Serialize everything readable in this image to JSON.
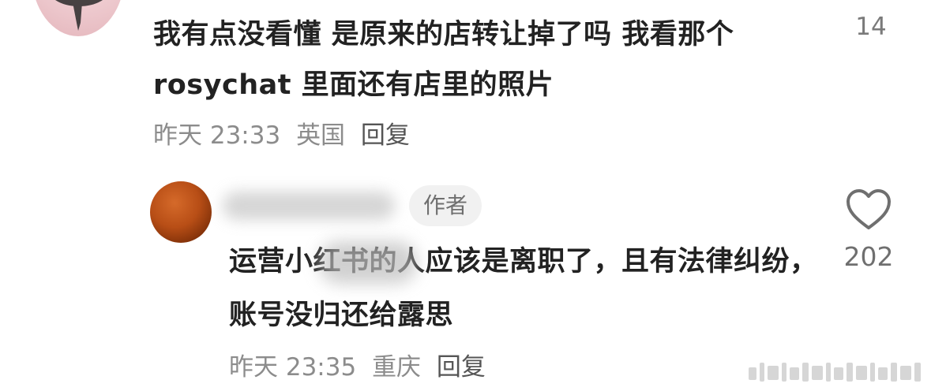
{
  "comment": {
    "text": "我有点没看懂 是原来的店转让掉了吗 我看那个 rosychat 里面还有店里的照片",
    "time": "昨天 23:33",
    "location": "英国",
    "reply_label": "回复",
    "likes": "14"
  },
  "reply": {
    "author_badge": "作者",
    "text": "运营小红书的人应该是离职了，且有法律纠纷，账号没归还给露思",
    "time": "昨天 23:35",
    "location": "重庆",
    "reply_label": "回复",
    "likes": "202",
    "heart_icon": "heart-outline-icon"
  },
  "colors": {
    "text_primary": "#222222",
    "text_meta": "#8c8c8c",
    "badge_bg": "#f1f1f1"
  }
}
